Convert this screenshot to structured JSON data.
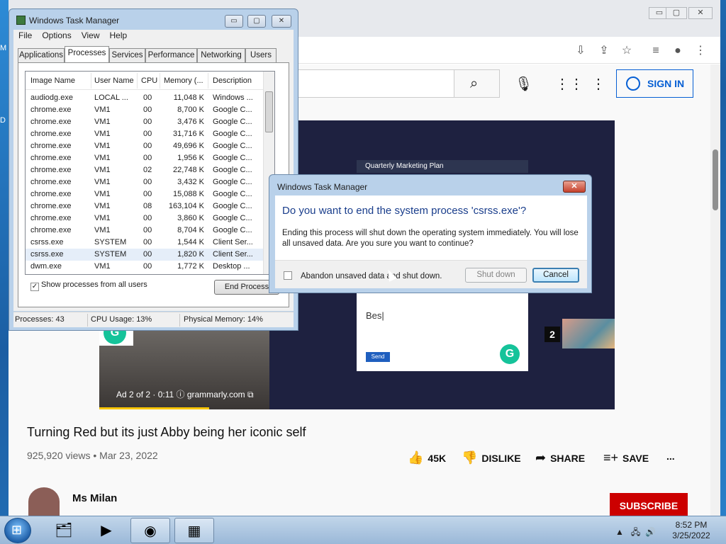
{
  "desktop": {
    "edge_labels": [
      "M",
      "D"
    ]
  },
  "browser": {
    "window_controls": {
      "minimize": "▭",
      "maximize": "▢",
      "close": "✕"
    }
  },
  "youtube": {
    "sign_in": "SIGN IN",
    "video": {
      "title": "Turning Red but its just Abby being her iconic self",
      "meta": "925,920 views • Mar 23, 2022",
      "likes": "45K",
      "dislike": "DISLIKE",
      "share": "SHARE",
      "save": "SAVE",
      "more": "...",
      "channel": "Ms Milan",
      "subscribe": "SUBSCRIBE",
      "ad_text": "Ad 2 of 2 · 0:11  ⓘ  grammarly.com ⧉",
      "ad_card_title": "Quarterly Marketing Plan",
      "ad_card_input": "Bes|",
      "ad_card_send": "Send",
      "grammarly_logo": "G",
      "next_index": "2"
    }
  },
  "task_manager": {
    "title": "Windows Task Manager",
    "menu": [
      "File",
      "Options",
      "View",
      "Help"
    ],
    "tabs": [
      "Applications",
      "Processes",
      "Services",
      "Performance",
      "Networking",
      "Users"
    ],
    "active_tab": "Processes",
    "columns": [
      "Image Name",
      "User Name",
      "CPU",
      "Memory (...",
      "Description"
    ],
    "rows": [
      {
        "image": "audiodg.exe",
        "user": "LOCAL ...",
        "cpu": "00",
        "mem": "11,048 K",
        "desc": "Windows ..."
      },
      {
        "image": "chrome.exe",
        "user": "VM1",
        "cpu": "00",
        "mem": "8,700 K",
        "desc": "Google C..."
      },
      {
        "image": "chrome.exe",
        "user": "VM1",
        "cpu": "00",
        "mem": "3,476 K",
        "desc": "Google C..."
      },
      {
        "image": "chrome.exe",
        "user": "VM1",
        "cpu": "00",
        "mem": "31,716 K",
        "desc": "Google C..."
      },
      {
        "image": "chrome.exe",
        "user": "VM1",
        "cpu": "00",
        "mem": "49,696 K",
        "desc": "Google C..."
      },
      {
        "image": "chrome.exe",
        "user": "VM1",
        "cpu": "00",
        "mem": "1,956 K",
        "desc": "Google C..."
      },
      {
        "image": "chrome.exe",
        "user": "VM1",
        "cpu": "02",
        "mem": "22,748 K",
        "desc": "Google C..."
      },
      {
        "image": "chrome.exe",
        "user": "VM1",
        "cpu": "00",
        "mem": "3,432 K",
        "desc": "Google C..."
      },
      {
        "image": "chrome.exe",
        "user": "VM1",
        "cpu": "00",
        "mem": "15,088 K",
        "desc": "Google C..."
      },
      {
        "image": "chrome.exe",
        "user": "VM1",
        "cpu": "08",
        "mem": "163,104 K",
        "desc": "Google C..."
      },
      {
        "image": "chrome.exe",
        "user": "VM1",
        "cpu": "00",
        "mem": "3,860 K",
        "desc": "Google C..."
      },
      {
        "image": "chrome.exe",
        "user": "VM1",
        "cpu": "00",
        "mem": "8,704 K",
        "desc": "Google C..."
      },
      {
        "image": "csrss.exe",
        "user": "SYSTEM",
        "cpu": "00",
        "mem": "1,544 K",
        "desc": "Client Ser..."
      },
      {
        "image": "csrss.exe",
        "user": "SYSTEM",
        "cpu": "00",
        "mem": "1,820 K",
        "desc": "Client Ser..."
      },
      {
        "image": "dwm.exe",
        "user": "VM1",
        "cpu": "00",
        "mem": "1,772 K",
        "desc": "Desktop ..."
      }
    ],
    "selected_row_index": 13,
    "show_all_label": "Show processes from all users",
    "show_all_checked": true,
    "end_process": "End Process",
    "status": {
      "processes": "Processes: 43",
      "cpu": "CPU Usage: 13%",
      "memory": "Physical Memory: 14%"
    }
  },
  "dialog": {
    "title": "Windows Task Manager",
    "close": "✕",
    "heading": "Do you want to end the system process 'csrss.exe'?",
    "body": "Ending this process will shut down the operating system immediately.  You will lose all unsaved data.  Are you sure you want to continue?",
    "checkbox_label": "Abandon unsaved data and shut down.",
    "shutdown": "Shut down",
    "cancel": "Cancel"
  },
  "taskbar": {
    "apps": [
      "explorer",
      "media-player",
      "chrome",
      "task-manager"
    ],
    "time": "8:52 PM",
    "date": "3/25/2022"
  },
  "colors": {
    "accent": "#065fd4",
    "subscribe": "#cc0000",
    "grammarly": "#15c39a",
    "dialog_heading": "#1a3e8c"
  }
}
